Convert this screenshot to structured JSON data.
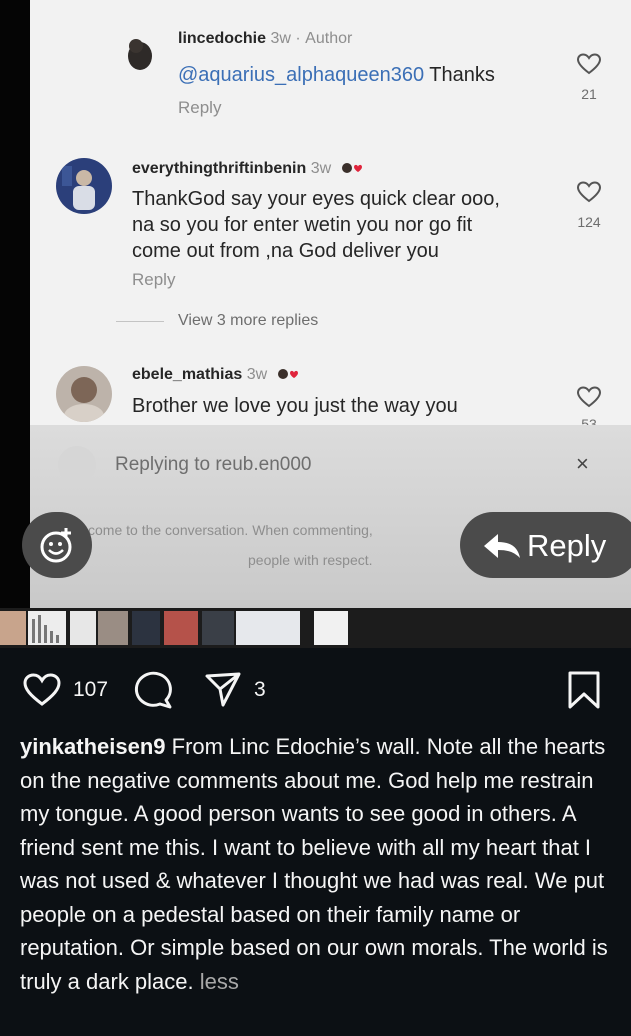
{
  "comments": [
    {
      "username": "lincedochie",
      "age": "3w",
      "sep": "·",
      "badge": "Author",
      "mention": "@aquarius_alphaqueen360",
      "text": " Thanks",
      "reply_label": "Reply",
      "likes": "21"
    },
    {
      "username": "everythingthriftinbenin",
      "age": "3w",
      "text_lines": [
        "ThankGod say your eyes quick clear ooo,",
        "na so you for enter wetin you nor go fit",
        "come out from ,na God deliver you"
      ],
      "reply_label": "Reply",
      "likes": "124",
      "view_more": "View 3 more replies"
    },
    {
      "username": "ebele_mathias",
      "age": "3w",
      "text": "Brother we love you just the way you",
      "likes": "53"
    }
  ],
  "replying_to": "Replying to reub.en000",
  "close_glyph": "×",
  "notice_line1": "come to the conversation. When commenting,",
  "notice_line2": "people with respect.",
  "reply_button_label": "Reply",
  "post": {
    "likes": "107",
    "shares": "3",
    "caption_user": "yinkatheisen9",
    "caption_text": " From Linc Edochie’s wall. Note all the hearts on the negative comments about me. God help me restrain my tongue. A good person wants to see good in others. A friend sent me this. I want to believe with all my heart that I was not used & whatever I thought we had was real. We put people on a pedestal based on their family name or reputation. Or simple based on our own morals. The world is truly a dark place.",
    "less_label": "less"
  },
  "icons": {
    "heart": "heart-icon",
    "comment": "comment-icon",
    "share": "share-icon",
    "save": "bookmark-icon",
    "emoji": "add-emoji-icon",
    "reply": "reply-arrow-icon"
  }
}
